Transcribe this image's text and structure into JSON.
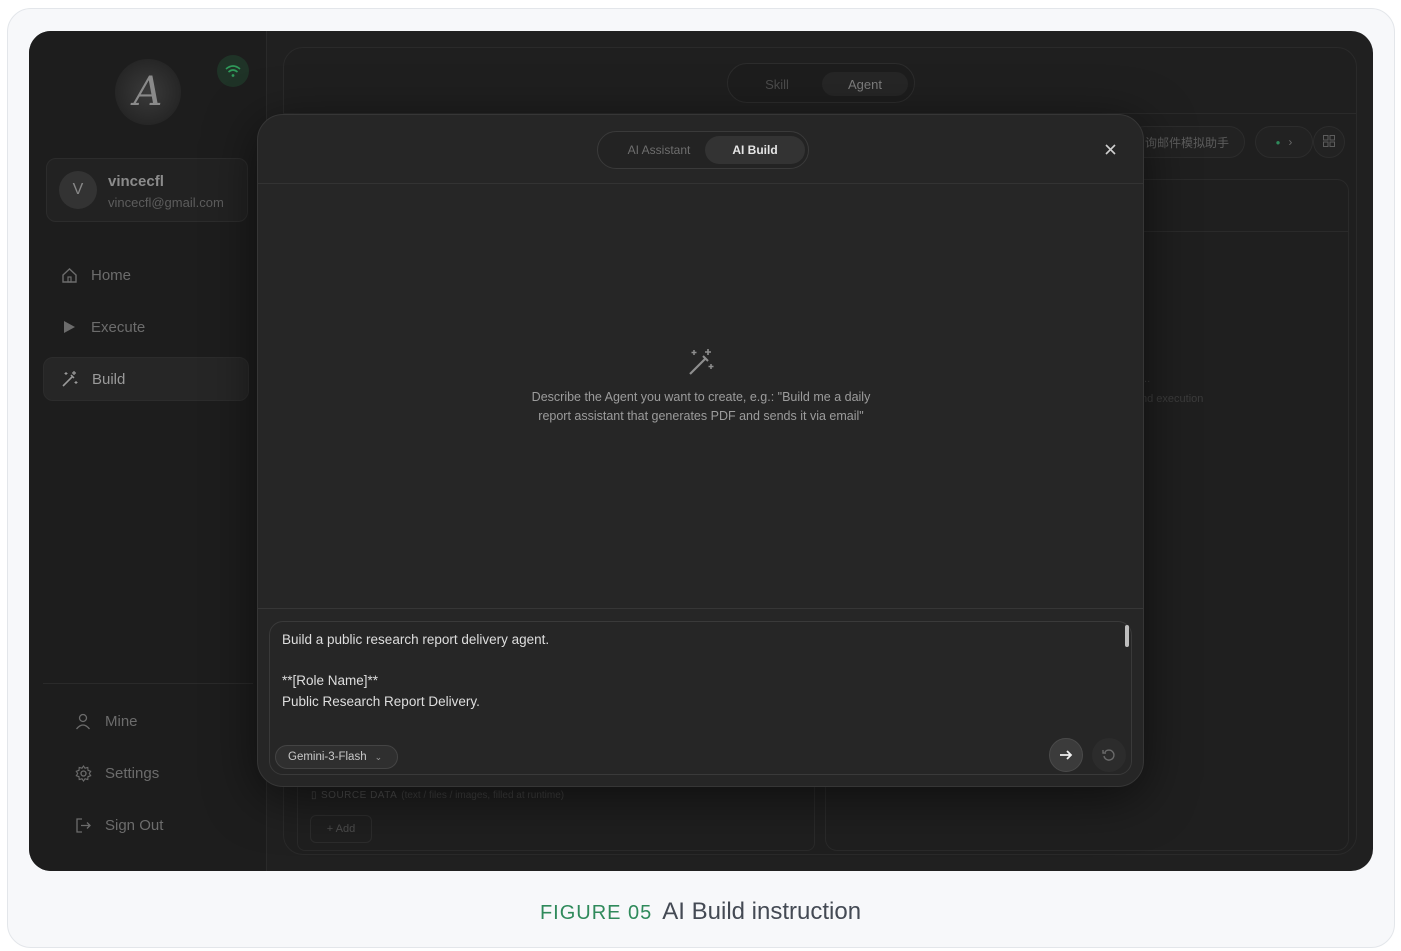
{
  "sidebar": {
    "logo_letter": "A",
    "user": {
      "initial": "V",
      "name": "vincecfl",
      "email": "vincecfl@gmail.com"
    },
    "nav": [
      {
        "label": "Home",
        "icon": "home-icon"
      },
      {
        "label": "Execute",
        "icon": "play-icon"
      },
      {
        "label": "Build",
        "icon": "magic-wand-icon",
        "active": true
      }
    ],
    "bottom": [
      {
        "label": "Mine",
        "icon": "user-icon"
      },
      {
        "label": "Settings",
        "icon": "gear-icon"
      },
      {
        "label": "Sign Out",
        "icon": "sign-out-icon"
      }
    ]
  },
  "background": {
    "tabs": [
      "Skill",
      "Agent"
    ],
    "active_tab": "Agent",
    "chip_cn": "询邮件模拟助手",
    "source_label": "SOURCE DATA",
    "source_hint": "(text / files / images, filled at runtime)",
    "add_label": "+ Add",
    "right_text_1": "...",
    "right_text_2": "nd execution"
  },
  "modal": {
    "tabs": [
      "AI Assistant",
      "AI Build"
    ],
    "active_tab": "AI Build",
    "empty_text": "Describe the Agent you want to create, e.g.: \"Build me a daily report assistant that generates PDF and sends it via email\"",
    "input_lines": [
      "Build a public research report delivery agent.",
      "",
      "**[Role Name]**",
      "Public Research Report Delivery."
    ],
    "model": "Gemini-3-Flash"
  },
  "caption": {
    "figure": "FIGURE 05",
    "title": "AI Build instruction"
  },
  "colors": {
    "accent_green": "#2f8a5b",
    "modal_bg": "#262626",
    "app_bg": "#202020"
  }
}
